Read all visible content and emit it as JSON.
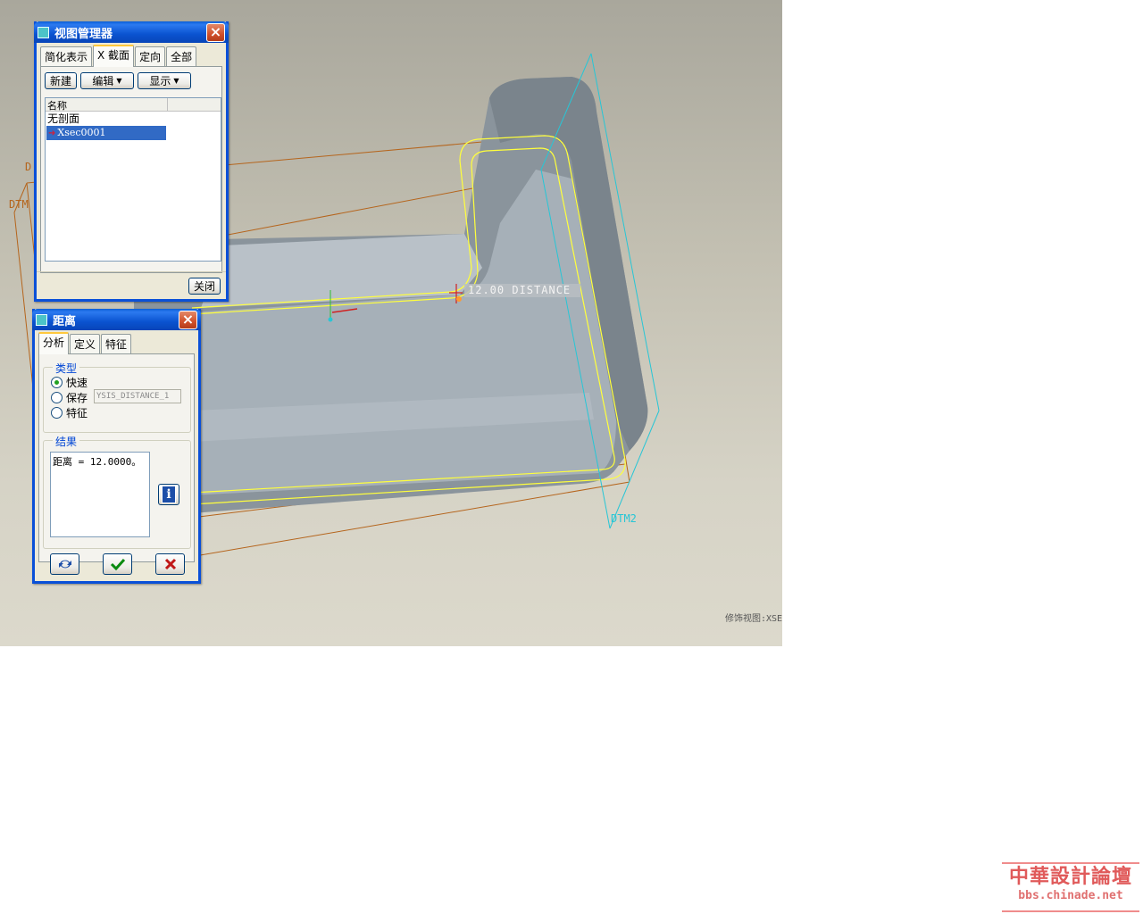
{
  "viewport": {
    "datum_label_a": "D",
    "datum_label_b": "DTM",
    "datum_label_c": "DTM2",
    "measure_label": "12.00  DISTANCE",
    "current_section": "修饰视图:XSEC"
  },
  "view_manager": {
    "title": "视图管理器",
    "tabs": [
      "简化表示",
      "X 截面",
      "定向",
      "全部"
    ],
    "active_tab": 1,
    "toolbar": {
      "new": "新建",
      "edit": "编辑",
      "display": "显示"
    },
    "list": {
      "header": "名称",
      "items": [
        "无剖面",
        "Xsec0001"
      ],
      "selected": 1
    },
    "close": "关闭"
  },
  "distance_dialog": {
    "title": "距离",
    "tabs": [
      "分析",
      "定义",
      "特征"
    ],
    "active_tab": 0,
    "type_group": "类型",
    "options": [
      "快速",
      "保存",
      "特征"
    ],
    "selected_option": 0,
    "analysis_name": "YSIS_DISTANCE_1",
    "result_group": "结果",
    "result_text": "距离 = 12.0000。"
  },
  "watermark": {
    "title": "中華設計論壇",
    "url": "bbs.chinade.net"
  },
  "colors": {
    "title_blue": "#0a53d0",
    "selection": "#316ac5",
    "section_outline": "#ffff3c",
    "datum_plane": "#27c6d6",
    "datum_brown": "#b5651d"
  }
}
